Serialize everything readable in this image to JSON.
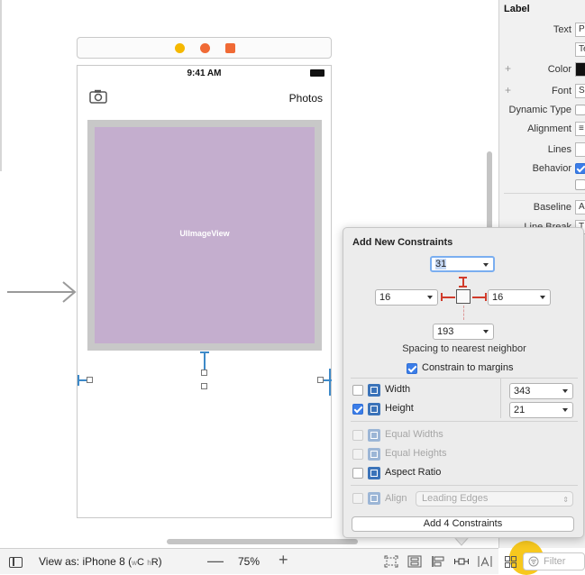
{
  "canvas": {
    "status_time": "9:41 AM",
    "nav_title": "Photos",
    "image_view_label": "UIImageView"
  },
  "inspector": {
    "title": "Label",
    "rows": [
      {
        "label": "Text",
        "control": "P",
        "plus": false
      },
      {
        "label": "",
        "control": "Te",
        "plus": false
      },
      {
        "label": "Color",
        "control": "",
        "plus": true
      },
      {
        "label": "Font",
        "control": "S",
        "plus": true
      },
      {
        "label": "Dynamic Type",
        "control": "",
        "plus": false
      },
      {
        "label": "Alignment",
        "control": "≡",
        "plus": false
      },
      {
        "label": "Lines",
        "control": "",
        "plus": false
      },
      {
        "label": "Behavior",
        "control": "",
        "plus": false
      },
      {
        "label": "",
        "control": "",
        "plus": false
      },
      {
        "label": "Baseline",
        "control": "A",
        "plus": false
      },
      {
        "label": "Line Break",
        "control": "T",
        "plus": false
      }
    ],
    "filter_placeholder": "Filter"
  },
  "bottombar": {
    "view_as_prefix": "View as: iPhone 8 (",
    "size_w": "w",
    "size_c": "C",
    "size_h": "h",
    "size_r": "R",
    "view_as_suffix": ")",
    "zoom_minus": "—",
    "zoom_level": "75%",
    "zoom_plus": "+"
  },
  "popover": {
    "title": "Add New Constraints",
    "top_value": "31",
    "leading_value": "16",
    "trailing_value": "16",
    "bottom_value": "193",
    "spacing_label": "Spacing to nearest neighbor",
    "constrain_margins_label": "Constrain to margins",
    "constrain_margins_checked": true,
    "width_label": "Width",
    "width_value": "343",
    "width_checked": false,
    "height_label": "Height",
    "height_value": "21",
    "height_checked": true,
    "equal_widths_label": "Equal Widths",
    "equal_heights_label": "Equal Heights",
    "aspect_ratio_label": "Aspect Ratio",
    "align_label": "Align",
    "align_value": "Leading Edges",
    "add_button_label": "Add 4 Constraints"
  },
  "colors": {
    "image_view_fill": "#c4aece",
    "constraint_blue": "#3d89c8",
    "strut_red": "#d13b2b",
    "checkbox_blue": "#3b7de8"
  }
}
